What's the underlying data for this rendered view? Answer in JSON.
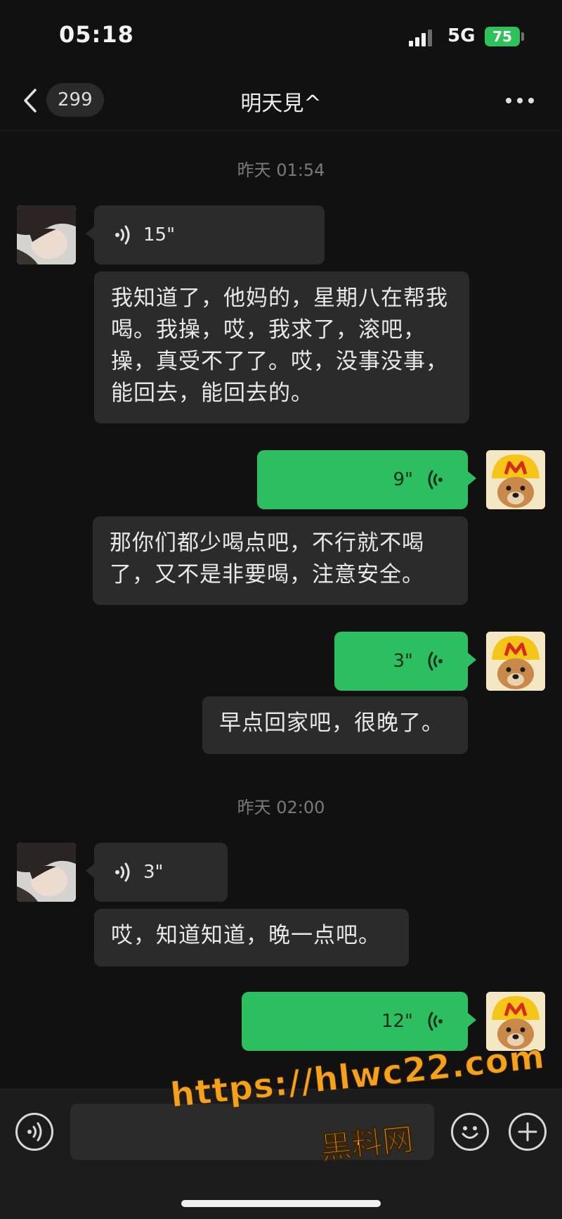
{
  "status_bar": {
    "time": "05:18",
    "network": "5G",
    "battery": "75"
  },
  "nav": {
    "unread_count": "299",
    "title": "明天見^"
  },
  "timestamps": [
    "昨天 01:54",
    "昨天 02:00"
  ],
  "messages": [
    {
      "sender": "contact",
      "voice_duration": "15\"",
      "transcript": "我知道了，他妈的，星期八在帮我喝。我操，哎，我求了，滚吧，操，真受不了了。哎，没事没事，能回去，能回去的。"
    },
    {
      "sender": "me",
      "voice_duration": "9\"",
      "transcript": "那你们都少喝点吧，不行就不喝了，又不是非要喝，注意安全。"
    },
    {
      "sender": "me",
      "voice_duration": "3\"",
      "transcript": "早点回家吧，很晚了。"
    },
    {
      "sender": "contact",
      "voice_duration": "3\"",
      "transcript": "哎，知道知道，晚一点吧。"
    },
    {
      "sender": "me",
      "voice_duration": "12\"",
      "transcript": ""
    }
  ],
  "watermark": {
    "url": "https://hlwc22.com",
    "name": "黑料网"
  },
  "colors": {
    "background": "#111111",
    "incoming_bubble": "#2b2b2b",
    "outgoing_bubble": "#2cbe61",
    "battery": "#2fc25b",
    "watermark": "#f5a11a"
  },
  "icons": [
    "back-chevron-icon",
    "more-dots-icon",
    "voice-wave-icon",
    "voice-mode-icon",
    "emoji-icon",
    "plus-icon"
  ]
}
